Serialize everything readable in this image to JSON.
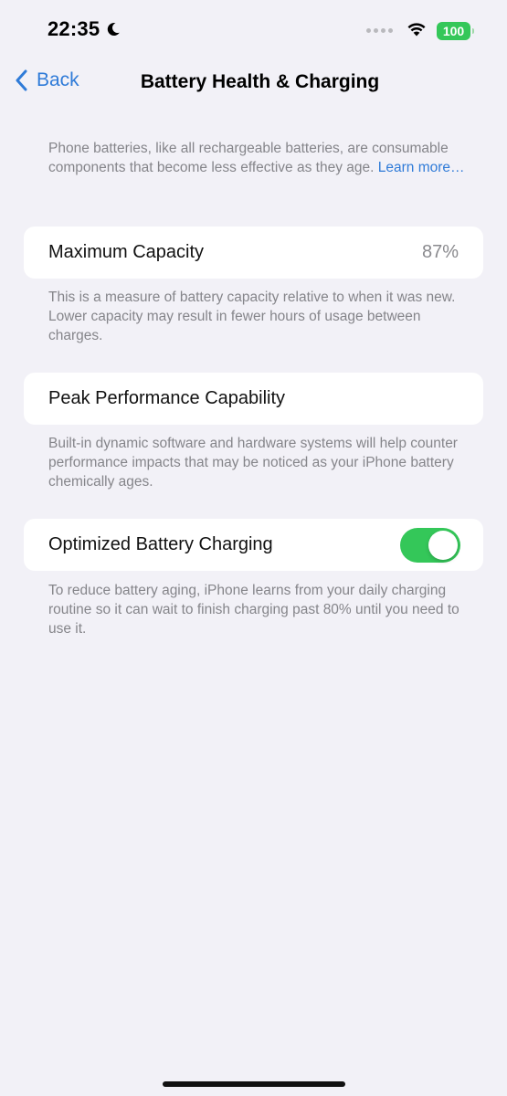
{
  "status_bar": {
    "time": "22:35",
    "battery_level": "100",
    "moon_icon": "moon-icon",
    "wifi_icon": "wifi-icon",
    "battery_color": "#34c759"
  },
  "nav": {
    "back_label": "Back",
    "title": "Battery Health & Charging",
    "accent_color": "#2f7bd8"
  },
  "intro": {
    "text": "Phone batteries, like all rechargeable batteries, are consumable components that become less effective as they age.",
    "link": "Learn more…"
  },
  "maximum_capacity": {
    "label": "Maximum Capacity",
    "value": "87%",
    "footnote": "This is a measure of battery capacity relative to when it was new. Lower capacity may result in fewer hours of usage between charges."
  },
  "peak_performance": {
    "label": "Peak Performance Capability",
    "footnote": "Built-in dynamic software and hardware systems will help counter performance impacts that may be noticed as your iPhone battery chemically ages."
  },
  "optimized_charging": {
    "label": "Optimized Battery Charging",
    "enabled": true,
    "toggle_color": "#34c759",
    "footnote": "To reduce battery aging, iPhone learns from your daily charging routine so it can wait to finish charging past 80% until you need to use it."
  }
}
